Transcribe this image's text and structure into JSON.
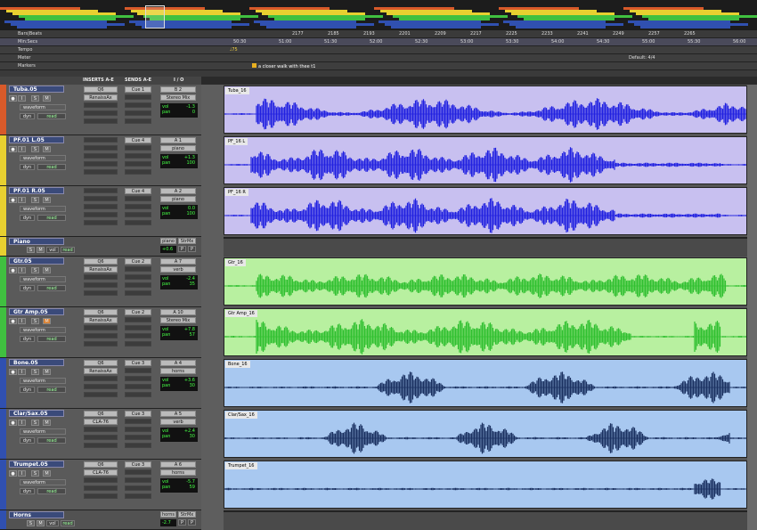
{
  "rulers": {
    "bars_label": "Bars|Beats",
    "min_label": "Min:Secs",
    "tempo_label": "Tempo",
    "meter_label": "Meter",
    "markers_label": "Markers",
    "tempo_value": "♩75",
    "meter_value": "Default: 4/4",
    "marker_text": "a closer walk with thee t1",
    "bars_ticks": [
      "2177",
      "2185",
      "2193",
      "2201",
      "2209",
      "2217",
      "2225",
      "2233",
      "2241",
      "2249",
      "2257",
      "2265"
    ],
    "min_ticks": [
      "50:30",
      "51:00",
      "51:30",
      "52:00",
      "52:30",
      "53:00",
      "53:30",
      "54:00",
      "54:30",
      "55:00",
      "55:30",
      "56:00"
    ]
  },
  "columns": {
    "inserts": "INSERTS A-E",
    "sends": "SENDS A-E",
    "io": "I / O"
  },
  "tracks": [
    {
      "name": "Tuba.05",
      "color": "#d85a2a",
      "lane": "#c8c0f0",
      "wave": "#2020e0",
      "mode": "waveform",
      "auto": "read",
      "ins": [
        "Q6",
        "RenaissAx"
      ],
      "send": "Cue 1",
      "io_out": "B 2",
      "io_in": "Stereo Mix",
      "vol": "-1.3",
      "pan": "0",
      "clip": "Tuba_16"
    },
    {
      "name": "PF.01 L.05",
      "color": "#e8d030",
      "lane": "#c8c0f0",
      "wave": "#2020e0",
      "mode": "waveform",
      "auto": "read",
      "ins": [
        "",
        ""
      ],
      "send": "Cue 4",
      "io_out": "A 1",
      "io_in": "piano",
      "vol": "+1.3",
      "pan": "100",
      "clip": "PF_16 L"
    },
    {
      "name": "PF.01 R.05",
      "color": "#e8d030",
      "lane": "#c8c0f0",
      "wave": "#2020e0",
      "mode": "waveform",
      "auto": "read",
      "ins": [
        "",
        ""
      ],
      "send": "Cue 4",
      "io_out": "A 2",
      "io_in": "piano",
      "vol": "0.0",
      "pan": "100",
      "clip": "PF_16 R"
    },
    {
      "name": "Gtr.05",
      "color": "#40c040",
      "lane": "#b8f0a0",
      "wave": "#30c030",
      "mode": "waveform",
      "auto": "read",
      "ins": [
        "Q6",
        "RenaissAx"
      ],
      "send": "Cue 2",
      "io_out": "A 7",
      "io_in": "verb",
      "vol": "-2.4",
      "pan": "35",
      "clip": "Gtr_16"
    },
    {
      "name": "Gtr Amp.05",
      "color": "#40c040",
      "lane": "#b8f0a0",
      "wave": "#30c030",
      "mode": "waveform",
      "auto": "read",
      "ins": [
        "Q6",
        "RenaissAx"
      ],
      "send": "Cue 2",
      "io_out": "A 10",
      "io_in": "Stereo Mix",
      "vol": "+7.8",
      "pan": "57",
      "clip": "Gtr Amp_16"
    },
    {
      "name": "Bone.05",
      "color": "#3050b0",
      "lane": "#a8c8f0",
      "wave": "#1a3060",
      "mode": "waveform",
      "auto": "read",
      "ins": [
        "Q6",
        "RenaissAx"
      ],
      "send": "Cue 3",
      "io_out": "A 4",
      "io_in": "horns",
      "vol": "+3.6",
      "pan": "30",
      "clip": "Bone_16"
    },
    {
      "name": "Clar/Sax.05",
      "color": "#3050b0",
      "lane": "#a8c8f0",
      "wave": "#1a3060",
      "mode": "waveform",
      "auto": "read",
      "ins": [
        "Q6",
        "CLA-76"
      ],
      "send": "Cue 3",
      "io_out": "A 5",
      "io_in": "verb",
      "vol": "+2.4",
      "pan": "30",
      "clip": "Clar/Sax_16"
    },
    {
      "name": "Trumpet.05",
      "color": "#3050b0",
      "lane": "#a8c8f0",
      "wave": "#1a3060",
      "mode": "waveform",
      "auto": "read",
      "ins": [
        "Q6",
        "CLA-76"
      ],
      "send": "Cue 3",
      "io_out": "A 6",
      "io_in": "horns",
      "vol": "-5.7",
      "pan": "59",
      "clip": "Trumpet_16"
    }
  ],
  "aux": [
    {
      "name": "Piano",
      "vol": "+0.6",
      "io": "piano",
      "io2": "StrMx",
      "mode": "vol",
      "auto": "read",
      "p": "P"
    },
    {
      "name": "Horns",
      "vol": "-2.7",
      "io": "horns",
      "io2": "StrMx",
      "mode": "vol",
      "auto": "read",
      "p": "P"
    }
  ],
  "labels": {
    "i": "I",
    "s": "S",
    "m": "M",
    "r": "●",
    "dyn": "dyn",
    "vol": "vol",
    "pan": "pan"
  }
}
